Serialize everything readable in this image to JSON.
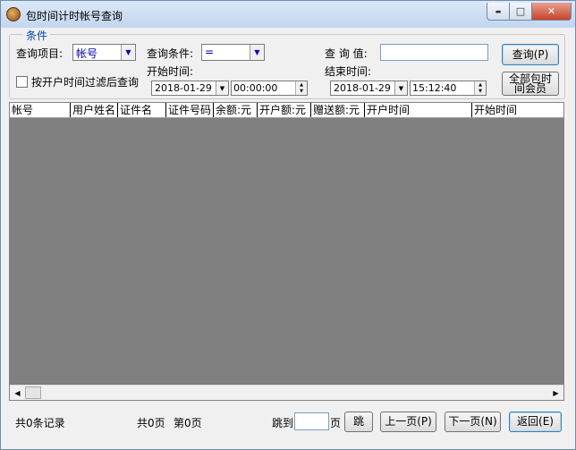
{
  "window": {
    "title": "包时间计时帐号查询",
    "minimize_glyph": "▬",
    "maximize_glyph": "□",
    "close_glyph": "✕"
  },
  "conditions": {
    "legend": "条件",
    "query_item_label": "查询项目:",
    "query_item_value": "帐号",
    "query_condition_label": "查询条件:",
    "query_condition_value": "=",
    "query_value_label": "查 询 值:",
    "query_value": "",
    "query_button": "查询(P)",
    "all_members_button_line1": "全部包时",
    "all_members_button_line2": "间会员",
    "filter_checkbox_label": "按开户时间过滤后查询",
    "start_time_label": "开始时间:",
    "start_date": "2018-01-29",
    "start_time": "00:00:00",
    "end_time_label": "结束时间:",
    "end_date": "2018-01-29",
    "end_time": "15:12:40"
  },
  "table": {
    "columns": [
      "帐号",
      "用户姓名",
      "证件名",
      "证件号码",
      "余额:元",
      "开户额:元",
      "赠送额:元",
      "开户时间",
      "开始时间"
    ]
  },
  "footer": {
    "total_records": "共0条记录",
    "total_pages": "共0页",
    "current_page": "第0页",
    "jump_label": "跳到",
    "jump_value": "",
    "page_unit": "页",
    "jump_button": "跳",
    "prev_button": "上一页(P)",
    "next_button": "下一页(N)",
    "back_button": "返回(E)"
  },
  "icons": {
    "dropdown": "▼",
    "scroll_left": "◀",
    "scroll_right": "▶",
    "spin_up": "▲",
    "spin_down": "▼"
  }
}
